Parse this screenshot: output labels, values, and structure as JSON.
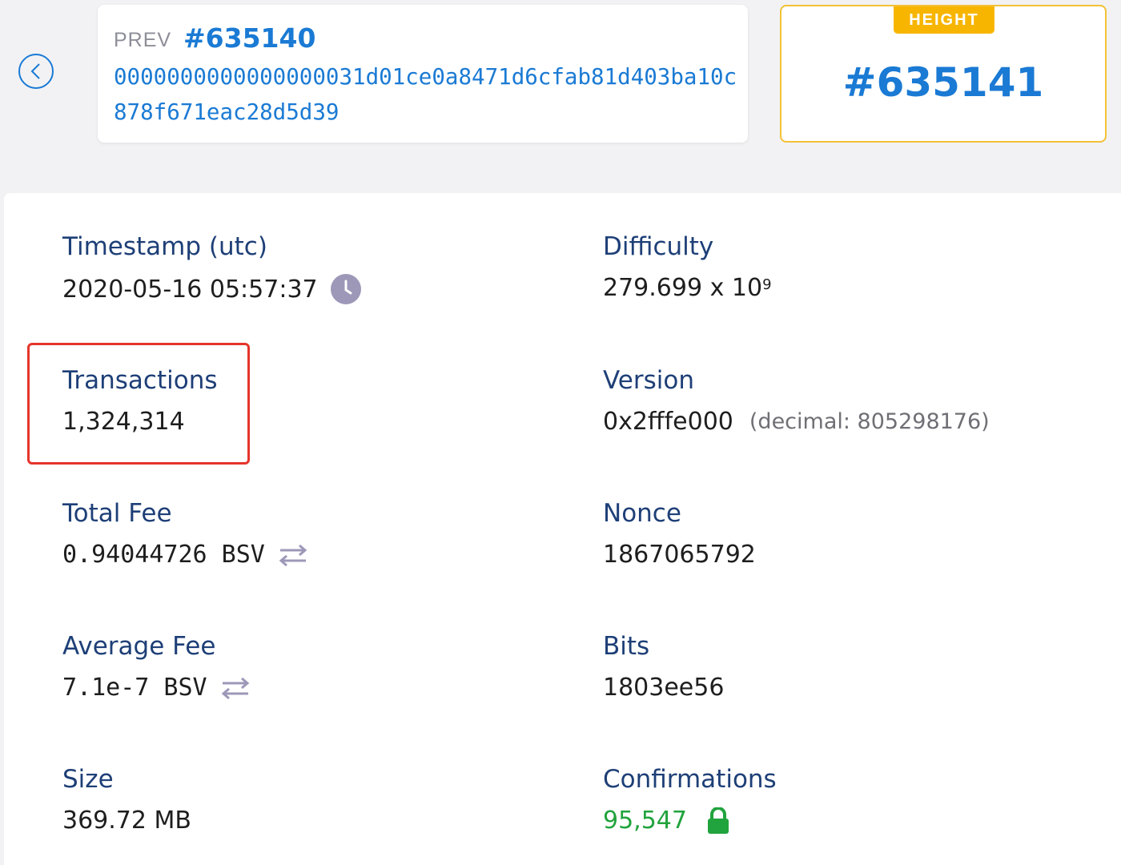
{
  "prev_block": {
    "label": "PREV",
    "number": "#635140",
    "hash": "0000000000000000031d01ce0a8471d6cfab81d403ba10c878f671eac28d5d39"
  },
  "height": {
    "badge": "HEIGHT",
    "value": "#635141"
  },
  "details": {
    "timestamp": {
      "label": "Timestamp (utc)",
      "value": "2020-05-16 05:57:37"
    },
    "difficulty": {
      "label": "Difficulty",
      "value": "279.699 x 10",
      "exponent": "9"
    },
    "transactions": {
      "label": "Transactions",
      "value": "1,324,314"
    },
    "version": {
      "label": "Version",
      "value": "0x2fffe000",
      "decimal_note": "(decimal: 805298176)"
    },
    "total_fee": {
      "label": "Total Fee",
      "value": "0.94044726 BSV"
    },
    "nonce": {
      "label": "Nonce",
      "value": "1867065792"
    },
    "average_fee": {
      "label": "Average Fee",
      "value": "7.1e-7 BSV"
    },
    "bits": {
      "label": "Bits",
      "value": "1803ee56"
    },
    "size": {
      "label": "Size",
      "value": "369.72 MB"
    },
    "confirmations": {
      "label": "Confirmations",
      "value": "95,547"
    }
  },
  "icons": {
    "back": "chevron-left-icon",
    "clock": "clock-icon",
    "swap": "swap-arrows-icon",
    "lock": "lock-icon"
  },
  "colors": {
    "accent_blue": "#1a7ad4",
    "label_navy": "#1e3f77",
    "height_gold": "#f7b500",
    "confirm_green": "#21a33d",
    "highlight_red": "#e5352b"
  }
}
